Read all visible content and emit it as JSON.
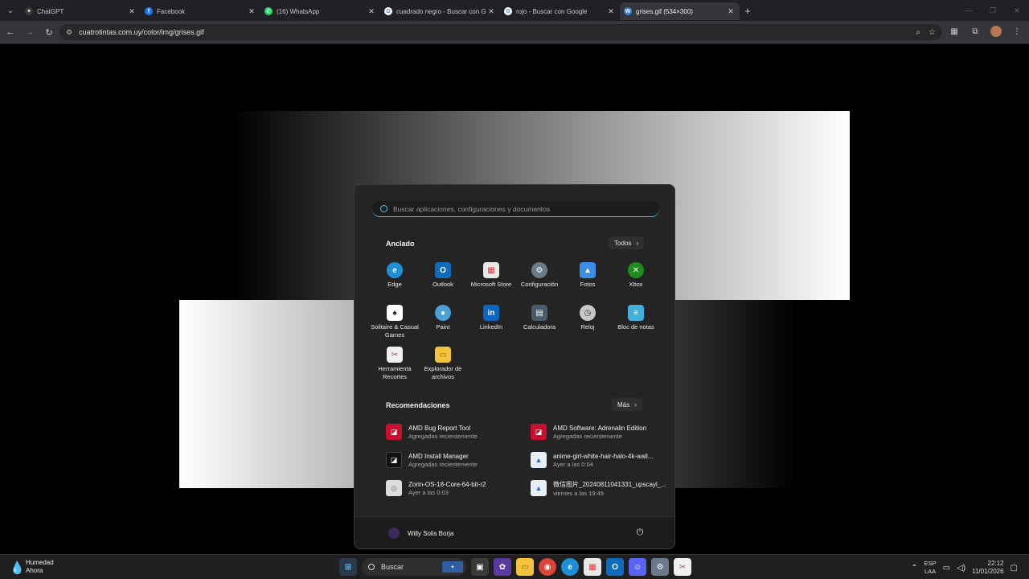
{
  "browser": {
    "tabs": [
      {
        "label": "ChatGPT",
        "icon": "chatgpt-icon",
        "color": "#3a3a3a"
      },
      {
        "label": "Facebook",
        "icon": "facebook-icon",
        "color": "#1877f2"
      },
      {
        "label": "(16) WhatsApp",
        "icon": "whatsapp-icon",
        "color": "#25d366"
      },
      {
        "label": "cuadrado negro - Buscar con Google",
        "icon": "google-icon",
        "color": "#ffffff"
      },
      {
        "label": "rojo - Buscar con Google",
        "icon": "google-icon",
        "color": "#ffffff"
      },
      {
        "label": "grises.gif (534×300)",
        "icon": "wordpress-icon",
        "color": "#3a7bd5"
      }
    ],
    "address": "cuatrotintas.com.uy/color/img/grises.gif"
  },
  "start_menu": {
    "search_placeholder": "Buscar aplicaciones, configuraciones y documentos",
    "pinned_title": "Anclado",
    "pinned_all": "Todos",
    "pinned": [
      {
        "label": "Edge",
        "icon": "edge-icon",
        "color": "#1d8fd6"
      },
      {
        "label": "Outlook",
        "icon": "outlook-icon",
        "color": "#0f6cbd"
      },
      {
        "label": "Microsoft Store",
        "icon": "store-icon",
        "color": "#e8e8e8"
      },
      {
        "label": "Configuración",
        "icon": "settings-icon",
        "color": "#6a7a8a"
      },
      {
        "label": "Fotos",
        "icon": "photos-icon",
        "color": "#3a8ee6"
      },
      {
        "label": "Xbox",
        "icon": "xbox-icon",
        "color": "#1e8c1e"
      },
      {
        "label": "Solitaire & Casual Games",
        "icon": "solitaire-icon",
        "color": "#ffffff"
      },
      {
        "label": "Paint",
        "icon": "paint-icon",
        "color": "#4aa0d8"
      },
      {
        "label": "LinkedIn",
        "icon": "linkedin-icon",
        "color": "#0a66c2"
      },
      {
        "label": "Calculadora",
        "icon": "calculator-icon",
        "color": "#4a5a6a"
      },
      {
        "label": "Reloj",
        "icon": "clock-icon",
        "color": "#c8c8c8"
      },
      {
        "label": "Bloc de notas",
        "icon": "notepad-icon",
        "color": "#3fb0e0"
      },
      {
        "label": "Herramienta Recortes",
        "icon": "snipping-icon",
        "color": "#f0f0f0"
      },
      {
        "label": "Explorador de archivos",
        "icon": "file-explorer-icon",
        "color": "#f5c33b"
      }
    ],
    "rec_title": "Recomendaciones",
    "rec_more": "Más",
    "recommendations": [
      {
        "name": "AMD Bug Report Tool",
        "sub": "Agregadas recientemente",
        "icon": "amd-icon",
        "color": "#c8102e"
      },
      {
        "name": "AMD Software: Adrenalin Edition",
        "sub": "Agregadas recientemente",
        "icon": "amd-icon",
        "color": "#c8102e"
      },
      {
        "name": "AMD Install Manager",
        "sub": "Agregadas recientemente",
        "icon": "amd-icon",
        "color": "#111111"
      },
      {
        "name": "anime-girl-white-hair-halo-4k-wall...",
        "sub": "Ayer a las 0:04",
        "icon": "image-file-icon",
        "color": "#e8eef6"
      },
      {
        "name": "Zorin-OS-18-Core-64-bit-r2",
        "sub": "Ayer a las 0:03",
        "icon": "disc-file-icon",
        "color": "#dddddd"
      },
      {
        "name": "微信图片_20240811041331_upscayl_...",
        "sub": "viernes a las 19:49",
        "icon": "image-file-icon",
        "color": "#e8eef6"
      }
    ],
    "user_name": "Willy Solis Borja"
  },
  "taskbar": {
    "weather_title": "Humedad",
    "weather_sub": "Ahora",
    "search_label": "Buscar",
    "lang_top": "ESP",
    "lang_bottom": "LAA",
    "time": "22:12",
    "date": "11/01/2026"
  }
}
